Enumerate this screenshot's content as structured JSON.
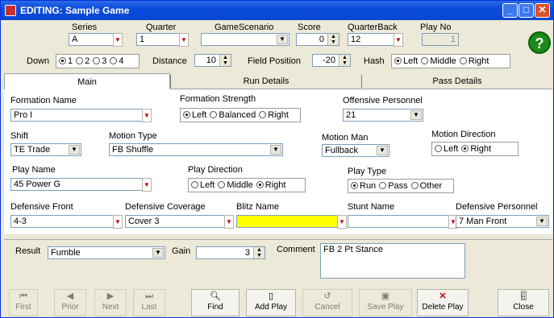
{
  "window": {
    "title": "EDITING: Sample Game"
  },
  "header": {
    "series": {
      "label": "Series",
      "value": "A"
    },
    "quarter": {
      "label": "Quarter",
      "value": "1"
    },
    "game_scenario": {
      "label": "GameScenario",
      "value": ""
    },
    "score": {
      "label": "Score",
      "value": "0"
    },
    "quarterback": {
      "label": "QuarterBack",
      "value": "12"
    },
    "play_no": {
      "label": "Play No",
      "value": "1"
    },
    "down": {
      "label": "Down",
      "options": [
        "1",
        "2",
        "3",
        "4"
      ],
      "selected": "1"
    },
    "distance": {
      "label": "Distance",
      "value": "10"
    },
    "field_position": {
      "label": "Field Position",
      "value": "-20"
    },
    "hash": {
      "label": "Hash",
      "options": [
        "Left",
        "Middle",
        "Right"
      ],
      "selected": "Left"
    }
  },
  "tabs": [
    {
      "label": "Main",
      "active": true
    },
    {
      "label": "Run Details"
    },
    {
      "label": "Pass Details"
    }
  ],
  "main": {
    "formation_name": {
      "label": "Formation Name",
      "value": "Pro I"
    },
    "formation_strength": {
      "label": "Formation Strength",
      "options": [
        "Left",
        "Balanced",
        "Right"
      ],
      "selected": "Left"
    },
    "offensive_personnel": {
      "label": "Offensive Personnel",
      "value": "21"
    },
    "shift": {
      "label": "Shift",
      "value": "TE Trade"
    },
    "motion_type": {
      "label": "Motion Type",
      "value": "FB Shuffle"
    },
    "motion_man": {
      "label": "Motion Man",
      "value": "Fullback"
    },
    "motion_direction": {
      "label": "Motion Direction",
      "options": [
        "Left",
        "Right"
      ],
      "selected": "Right"
    },
    "play_name": {
      "label": "Play Name",
      "value": "45 Power G"
    },
    "play_direction": {
      "label": "Play Direction",
      "options": [
        "Left",
        "Middle",
        "Right"
      ],
      "selected": "Right"
    },
    "play_type": {
      "label": "Play Type",
      "options": [
        "Run",
        "Pass",
        "Other"
      ],
      "selected": "Run"
    },
    "defensive_front": {
      "label": "Defensive Front",
      "value": "4-3"
    },
    "defensive_coverage": {
      "label": "Defensive Coverage",
      "value": "Cover 3"
    },
    "blitz_name": {
      "label": "Blitz Name",
      "value": ""
    },
    "stunt_name": {
      "label": "Stunt Name",
      "value": ""
    },
    "defensive_personnel": {
      "label": "Defensive Personnel",
      "value": "7 Man Front"
    }
  },
  "result": {
    "result": {
      "label": "Result",
      "value": "Fumble"
    },
    "gain": {
      "label": "Gain",
      "value": "3"
    },
    "comment": {
      "label": "Comment",
      "value": "FB 2 Pt Stance"
    }
  },
  "toolbar": {
    "first": "First",
    "prior": "Prior",
    "next": "Next",
    "last": "Last",
    "find": "Find",
    "add_play": "Add Play",
    "cancel": "Cancel",
    "save_play": "Save Play",
    "delete_play": "Delete Play",
    "close": "Close"
  },
  "help": {
    "label": "?"
  }
}
